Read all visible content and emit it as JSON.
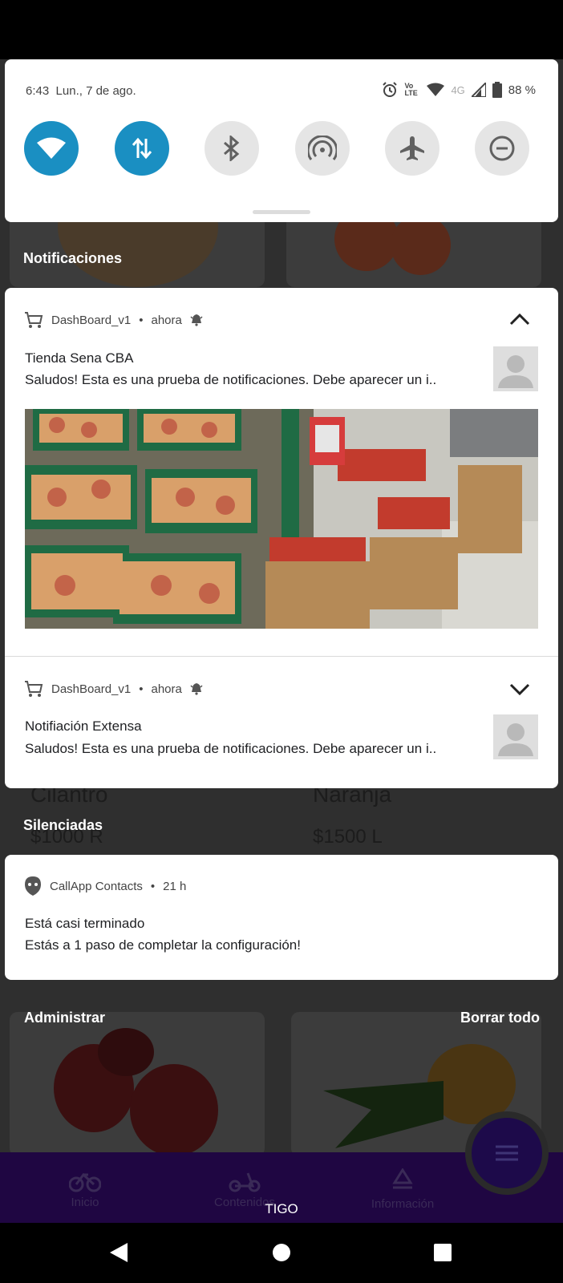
{
  "status_bar": {
    "time": "6:43",
    "date": "Lun., 7 de ago.",
    "network": "4G",
    "volte": "Vo LTE",
    "battery": "88 %"
  },
  "quick_settings": [
    {
      "name": "wifi",
      "icon": "wifi-icon",
      "on": true
    },
    {
      "name": "mobile-data",
      "icon": "data-arrows-icon",
      "on": true
    },
    {
      "name": "bluetooth",
      "icon": "bluetooth-icon",
      "on": false
    },
    {
      "name": "hotspot",
      "icon": "hotspot-icon",
      "on": false
    },
    {
      "name": "airplane-mode",
      "icon": "airplane-icon",
      "on": false
    },
    {
      "name": "do-not-disturb",
      "icon": "do-not-disturb-icon",
      "on": false
    }
  ],
  "sections": {
    "notifications": "Notificaciones",
    "silenced": "Silenciadas",
    "manage": "Administrar",
    "clear_all": "Borrar todo"
  },
  "notifications": [
    {
      "app": "DashBoard_v1",
      "time": "ahora",
      "title": "Tienda Sena CBA",
      "text": "Saludos! Esta es una prueba de notificaciones. Debe aparecer un i..",
      "expanded": true
    },
    {
      "app": "DashBoard_v1",
      "time": "ahora",
      "title": "Notifiación Extensa",
      "text": "Saludos! Esta es una prueba de notificaciones. Debe aparecer un i..",
      "expanded": false
    }
  ],
  "silenced_notifications": [
    {
      "app": "CallApp Contacts",
      "time": "21 h",
      "title": "Está casi terminado",
      "text": "Estás a 1 paso de completar la configuración!"
    }
  ],
  "background_app": {
    "products": [
      {
        "name": "Cilantro",
        "price": "$1000 R"
      },
      {
        "name": "Naranja",
        "price": "$1500 L"
      }
    ],
    "nav": [
      "Inicio",
      "Contenidos",
      "Información"
    ],
    "carrier": "TIGO"
  },
  "separator": "•"
}
